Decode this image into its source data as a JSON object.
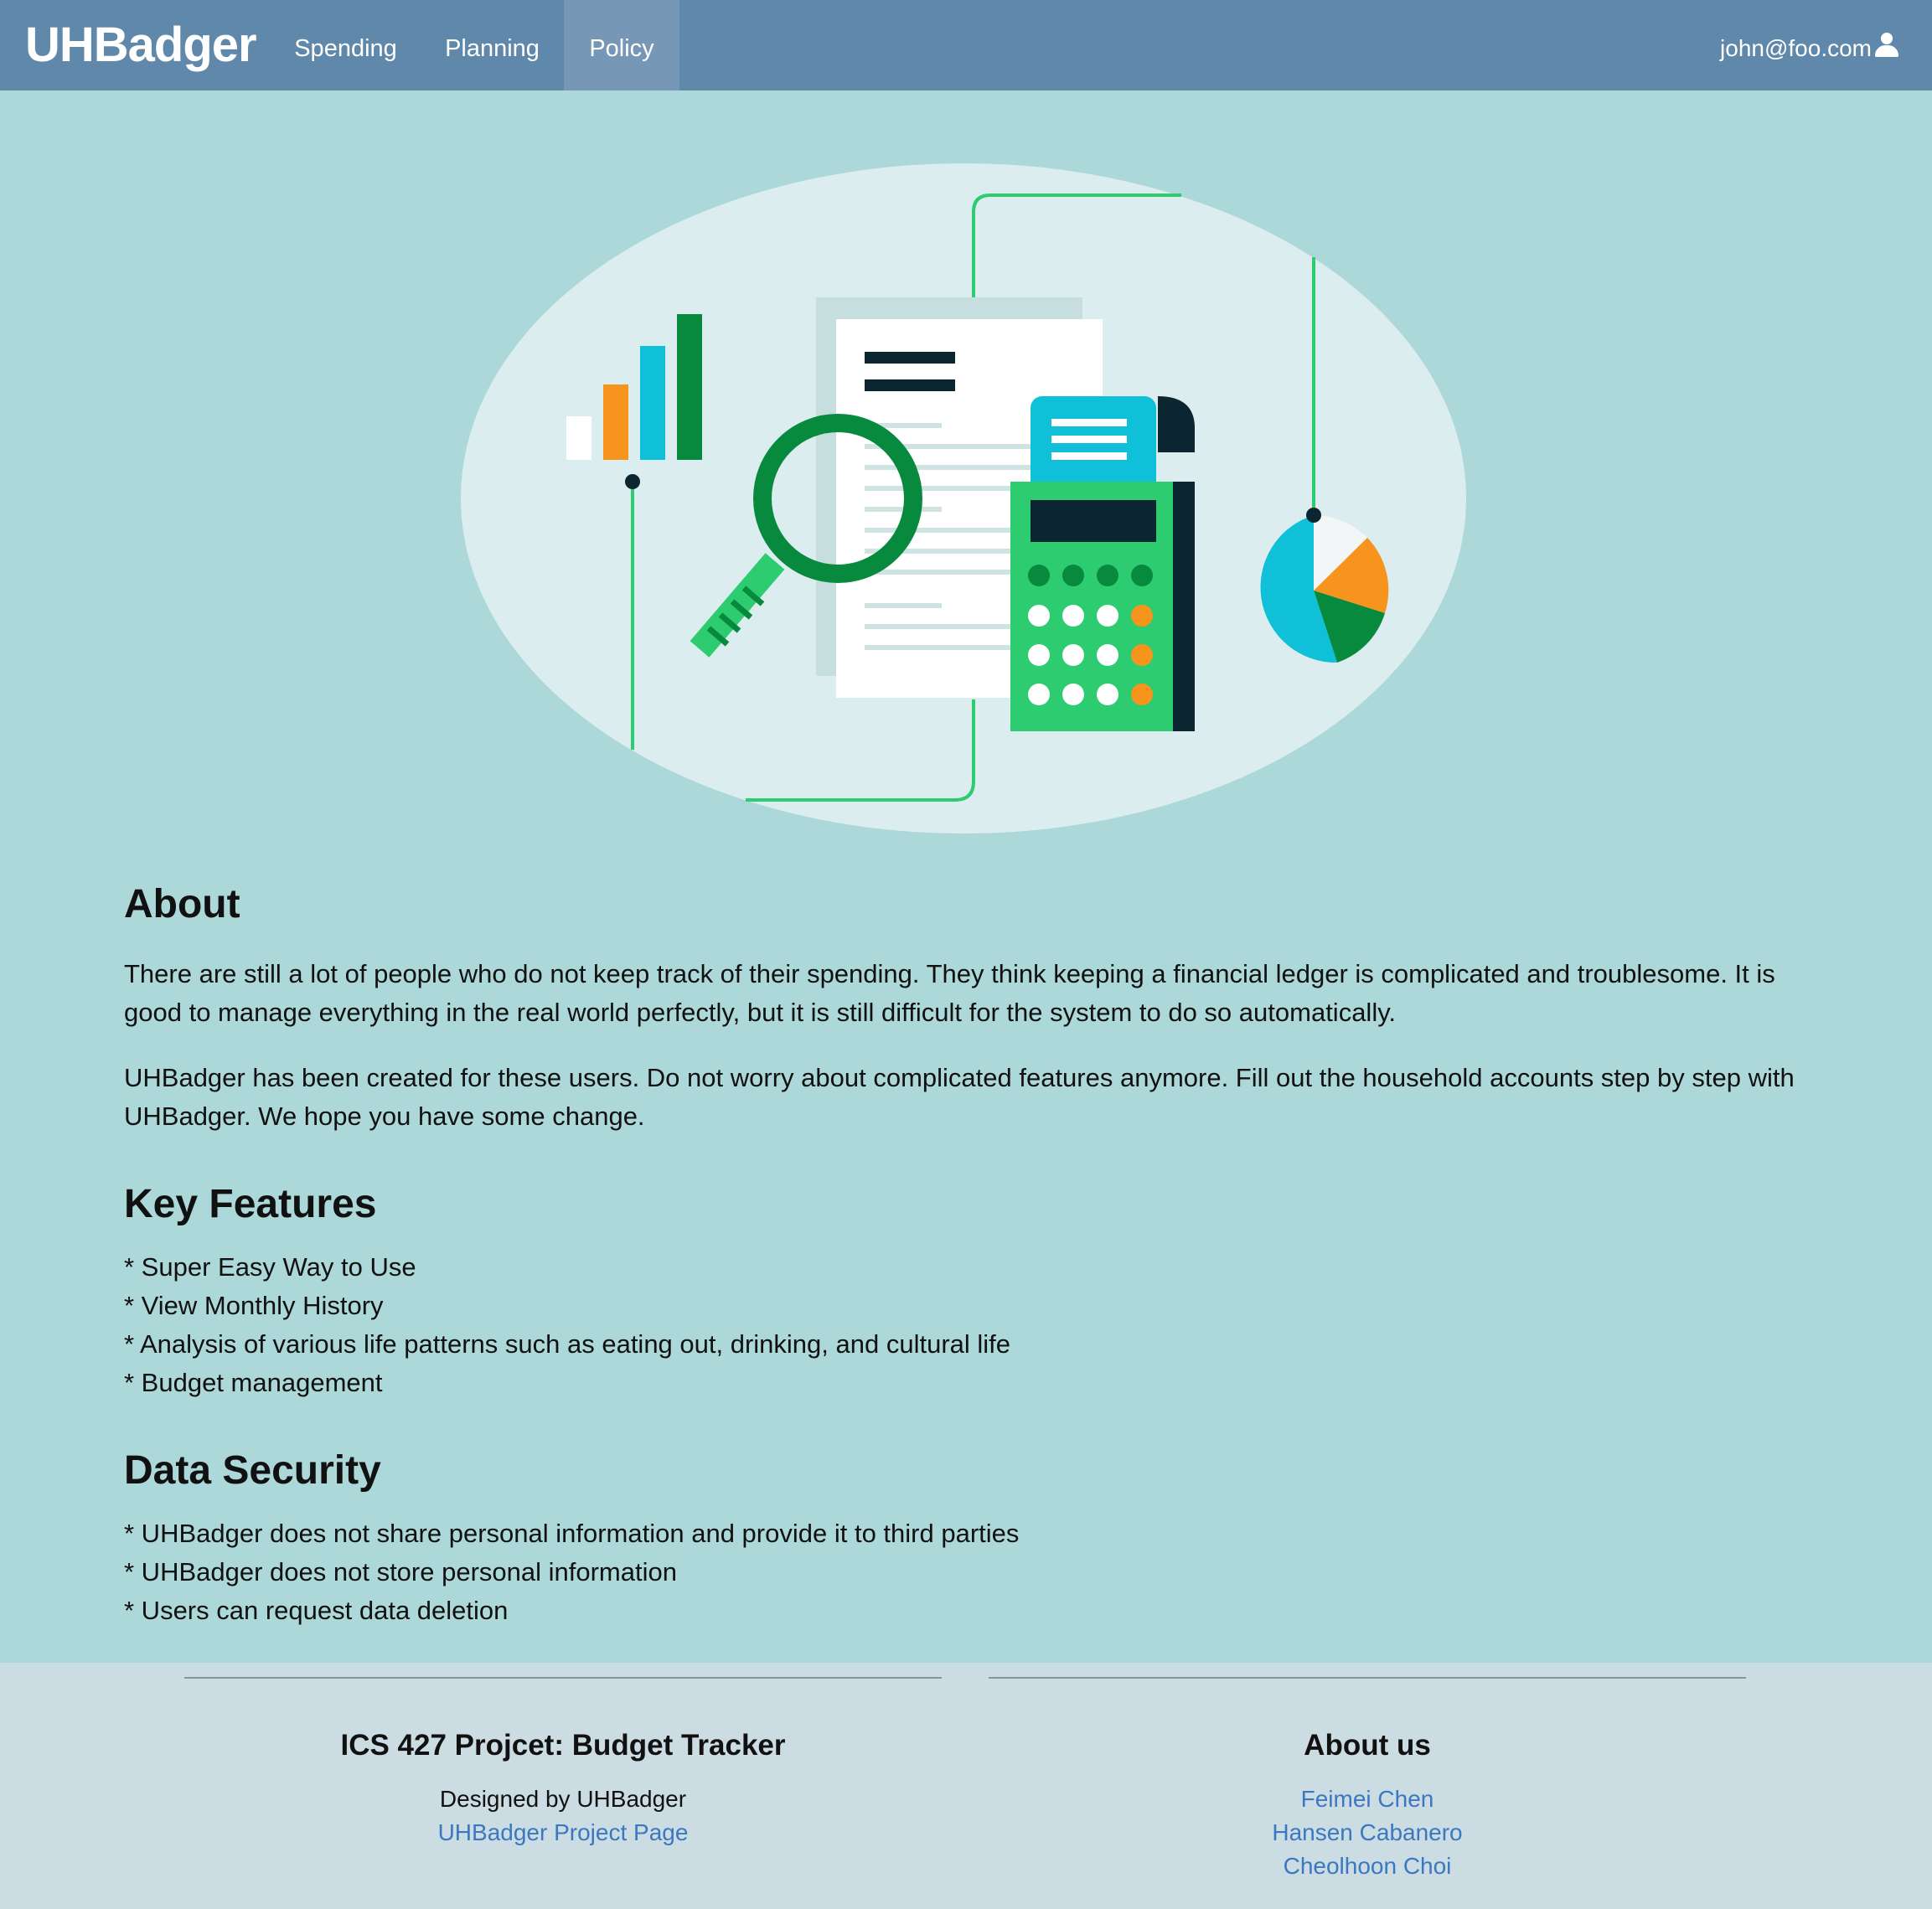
{
  "navbar": {
    "brand": "UHBadger",
    "items": [
      {
        "label": "Spending"
      },
      {
        "label": "Planning"
      },
      {
        "label": "Policy",
        "active": true
      }
    ],
    "user_email": "john@foo.com",
    "user_icon": "user-icon"
  },
  "colors": {
    "navbar": "#5f88aa",
    "page_background": "#acd8d9",
    "footer_background": "#ccdce3",
    "link": "#3b78c0"
  },
  "about": {
    "heading": "About",
    "paragraph1": "There are still a lot of people who do not keep track of their spending. They think keeping a financial ledger is complicated and troublesome. It is good to manage everything in the real world perfectly, but it is still difficult for the system to do so automatically.",
    "paragraph2": "UHBadger has been created for these users. Do not worry about complicated features anymore. Fill out the household accounts step by step with UHBadger. We hope you have some change."
  },
  "key_features": {
    "heading": "Key Features",
    "items": [
      "* Super Easy Way to Use",
      "* View Monthly History",
      "* Analysis of various life patterns such as eating out, drinking, and cultural life",
      "* Budget management"
    ]
  },
  "data_security": {
    "heading": "Data Security",
    "items": [
      "* UHBadger does not share personal information and provide it to third parties",
      "* UHBadger does not store personal information",
      "* Users can request data deletion"
    ]
  },
  "footer": {
    "left": {
      "title": "ICS 427 Projcet: Budget Tracker",
      "designed_by": "Designed by UHBadger",
      "project_link": "UHBadger Project Page"
    },
    "right": {
      "title": "About us",
      "members": [
        "Feimei Chen",
        "Hansen Cabanero",
        "Cheolhoon Choi"
      ]
    }
  }
}
